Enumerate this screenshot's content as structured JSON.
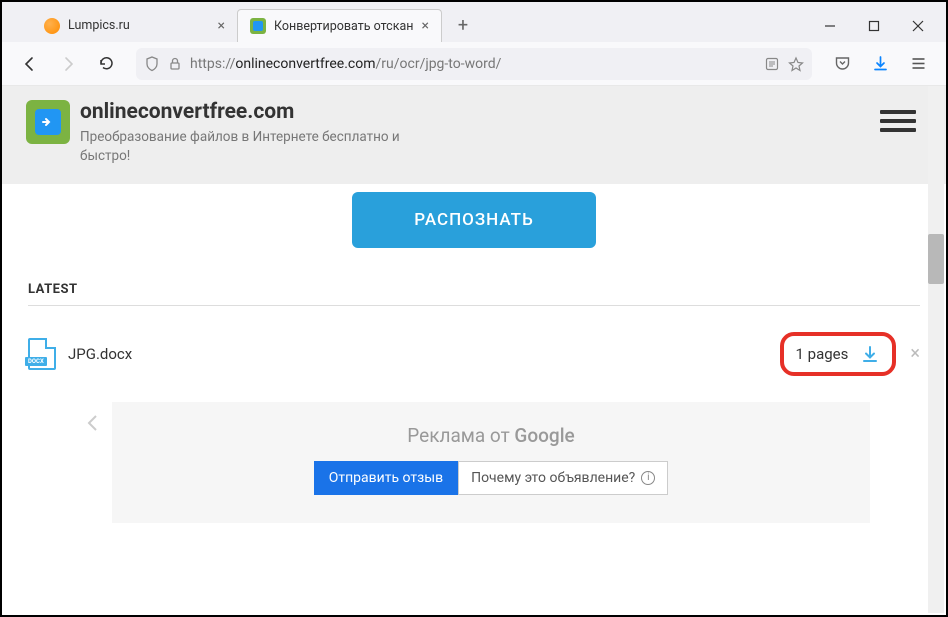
{
  "tabs": [
    {
      "title": "Lumpics.ru"
    },
    {
      "title": "Конвертировать отсканирован"
    }
  ],
  "url": {
    "prefix": "https://",
    "domain": "onlineconvertfree.com",
    "path": "/ru/ocr/jpg-to-word/"
  },
  "brand": {
    "title": "onlineconvertfree.com",
    "sub": "Преобразование файлов в Интернете бесплатно и быстро!"
  },
  "cta": "РАСПОЗНАТЬ",
  "latest_label": "LATEST",
  "file": {
    "name": "JPG.docx",
    "pages": "1 pages",
    "badge": "DOCX"
  },
  "ad": {
    "title_prefix": "Реклама от ",
    "google": "Google",
    "send": "Отправить отзыв",
    "why": "Почему это объявление?"
  }
}
